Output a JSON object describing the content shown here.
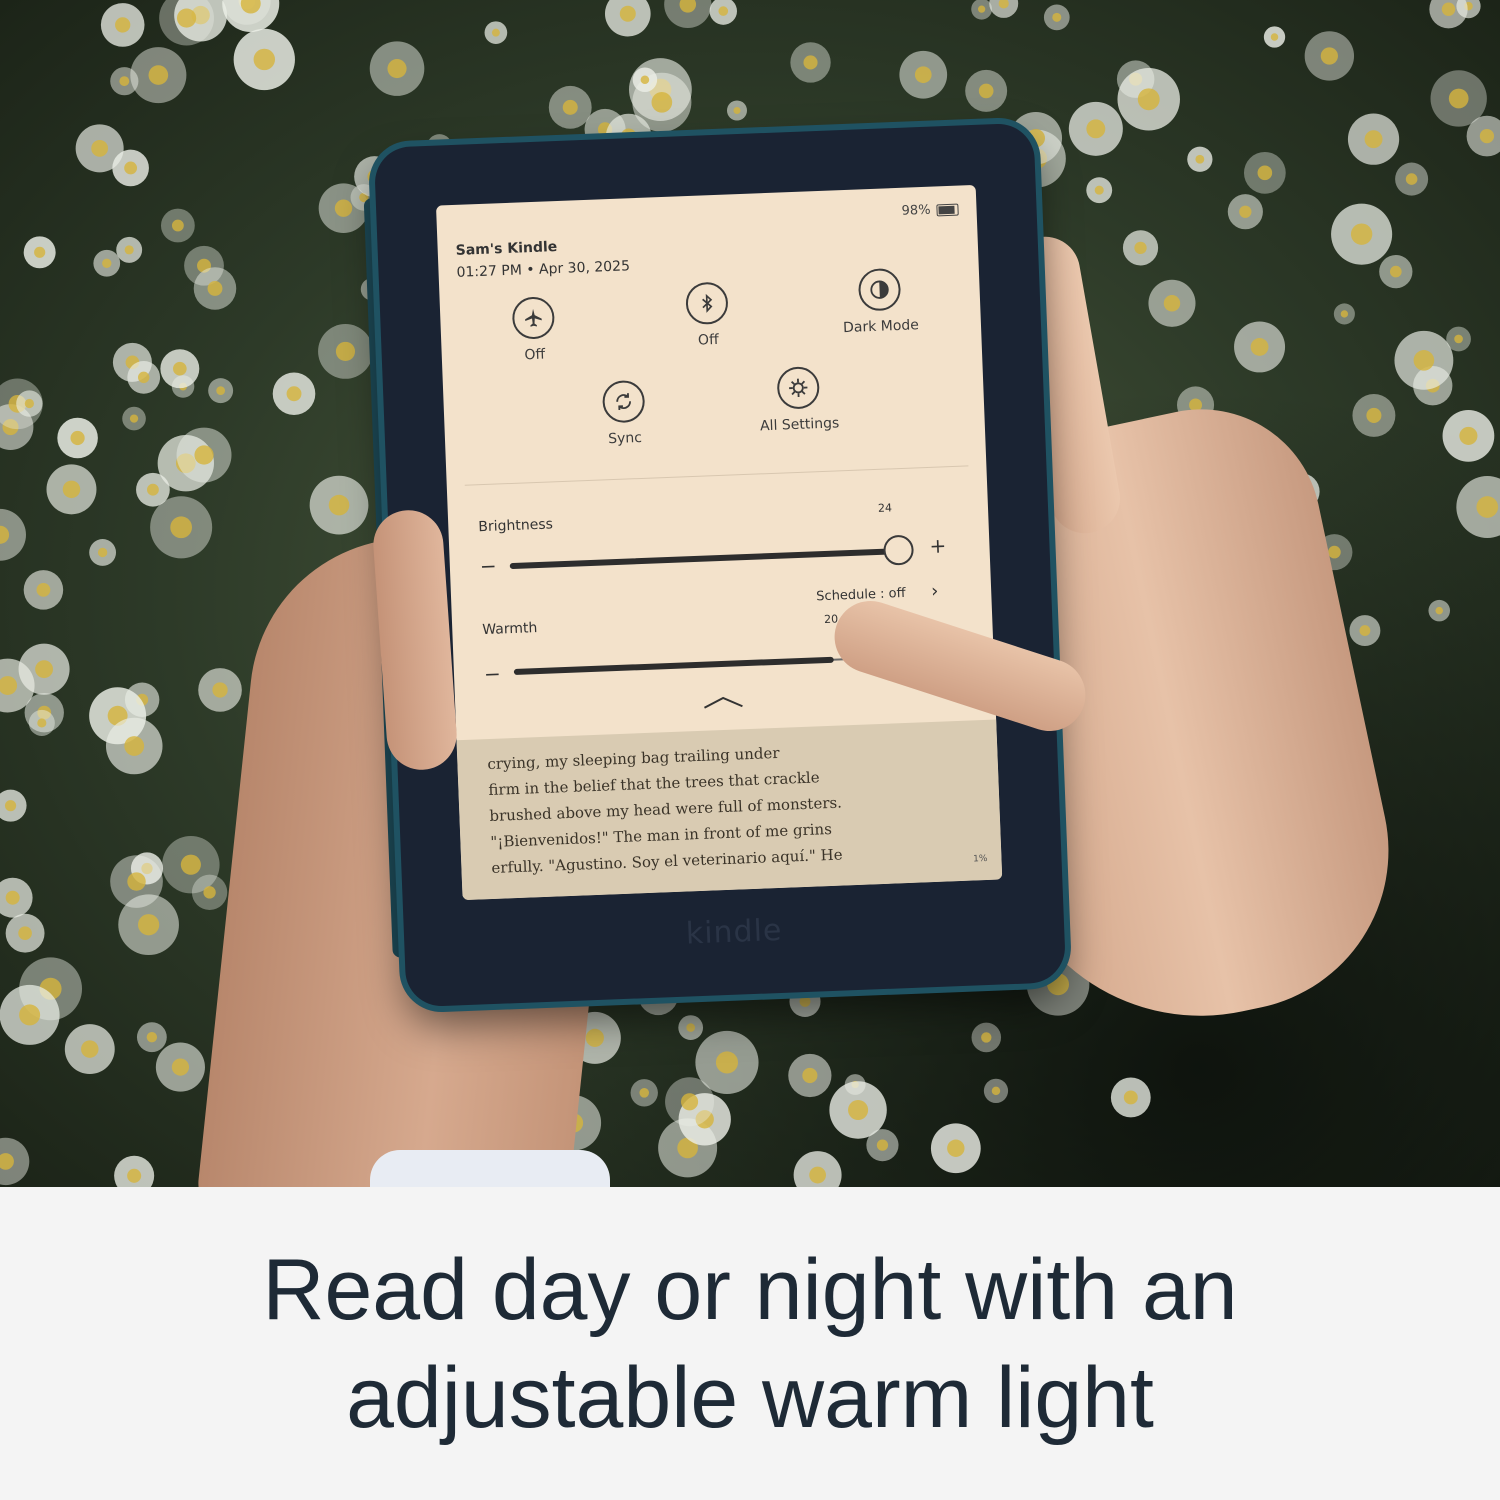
{
  "status": {
    "battery": "98%"
  },
  "device": {
    "name": "Sam's Kindle",
    "datetime": "01:27 PM • Apr 30, 2025",
    "brand": "kindle"
  },
  "quick_actions": [
    {
      "icon": "airplane-icon",
      "label": "Off"
    },
    {
      "icon": "bluetooth-icon",
      "label": "Off"
    },
    {
      "icon": "dark-mode-icon",
      "label": "Dark Mode"
    },
    {
      "icon": "sync-icon",
      "label": "Sync"
    },
    {
      "icon": "settings-icon",
      "label": "All Settings"
    }
  ],
  "brightness": {
    "label": "Brightness",
    "value": "24",
    "fraction": 1.0
  },
  "warmth": {
    "label": "Warmth",
    "value": "20",
    "fraction": 0.8,
    "schedule": "Schedule : off"
  },
  "book": {
    "lines": [
      "crying, my sleeping bag trailing under",
      "firm in the belief that the trees that crackle",
      "brushed above my head were full of monsters.",
      "\"¡Bienvenidos!\" The man in front of me grins",
      "erfully. \"Agustino. Soy el veterinario aquí.\" He"
    ],
    "progress": "1%"
  },
  "caption": {
    "line1": "Read day or night with an",
    "line2": "adjustable warm light"
  },
  "colors": {
    "screen": "#f3e2cb",
    "device": "#1a2333",
    "cover": "#1f5262",
    "caption_text": "#1e2a36"
  }
}
